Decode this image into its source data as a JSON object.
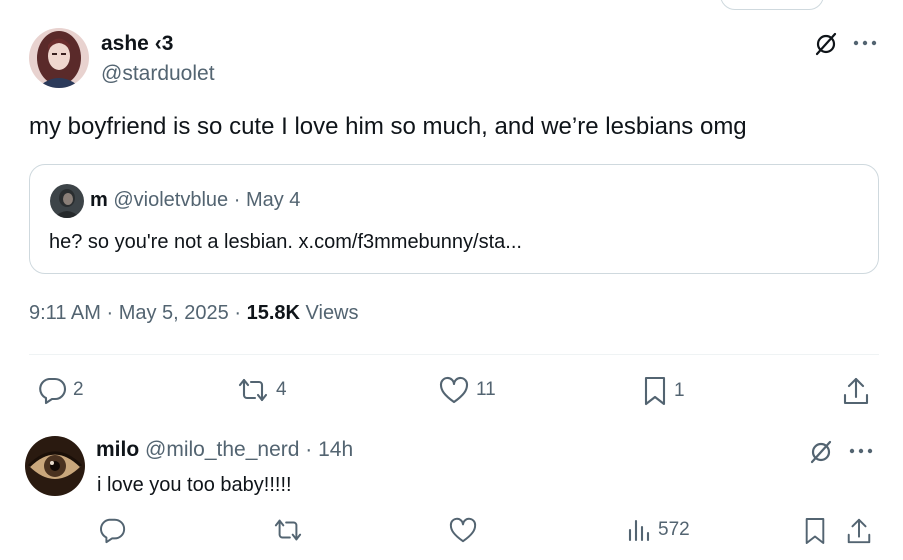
{
  "main_tweet": {
    "author": {
      "display_name": "ashe ‹3",
      "handle": "@starduolet"
    },
    "text": "my boyfriend is so cute I love him so much, and we’re lesbians omg",
    "quote": {
      "display_name": "m",
      "handle": "@violetvblue",
      "separator": "·",
      "date": "May 4",
      "text": "he? so you're not a lesbian. x.com/f3mmebunny/sta..."
    },
    "meta": {
      "time": "9:11 AM",
      "separator": "·",
      "date": "May 5, 2025",
      "views_count": "15.8K",
      "views_label": "Views"
    },
    "actions": {
      "replies": "2",
      "reposts": "4",
      "likes": "11",
      "bookmarks": "1"
    }
  },
  "reply": {
    "display_name": "milo",
    "handle": "@milo_the_nerd",
    "separator": "·",
    "time": "14h",
    "text": "i love you too baby!!!!!",
    "actions": {
      "views": "572"
    }
  },
  "icons": {
    "grok": "grok-slash-circle-icon",
    "more": "more-dots-icon",
    "reply": "speech-bubble-icon",
    "repost": "repost-arrows-icon",
    "like": "heart-icon",
    "bookmark": "bookmark-icon",
    "share": "share-upload-icon",
    "views": "bar-chart-icon"
  },
  "colors": {
    "text": "#0f1419",
    "secondary": "#536471",
    "border": "#cfd9de"
  }
}
